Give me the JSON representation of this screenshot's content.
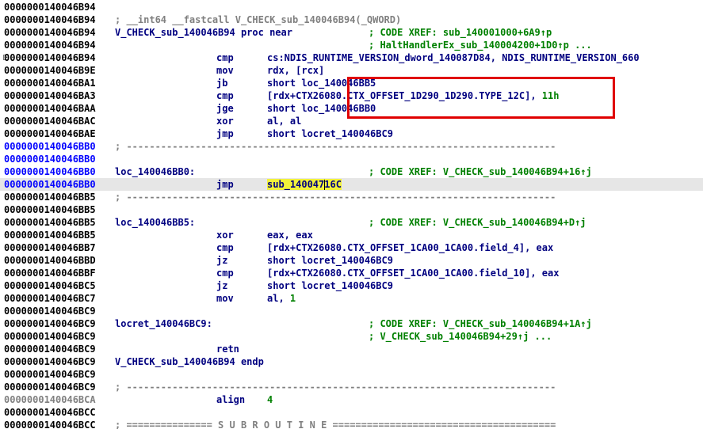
{
  "listing": [
    {
      "kind": "blank",
      "addr": "0000000140046B94",
      "addr_color": "black"
    },
    {
      "kind": "header",
      "addr": "0000000140046B94",
      "addr_color": "black",
      "text": "; __int64 __fastcall V_CHECK_sub_140046B94(_QWORD)"
    },
    {
      "kind": "proc",
      "addr": "0000000140046B94",
      "addr_color": "black",
      "label": "V_CHECK_sub_140046B94 proc near",
      "comment": "; CODE XREF: sub_140001000+6A9↑p"
    },
    {
      "kind": "xref-cont",
      "addr": "0000000140046B94",
      "addr_color": "black",
      "comment": "; HaltHandlerEx_sub_140004200+1D0↑p ..."
    },
    {
      "kind": "insn",
      "addr": "0000000140046B94",
      "addr_color": "black",
      "gutter": true,
      "mnem": "cmp",
      "oper": "cs:NDIS_RUNTIME_VERSION_dword_140087D84, NDIS_RUNTIME_VERSION_660"
    },
    {
      "kind": "insn",
      "addr": "0000000140046B9E",
      "addr_color": "black",
      "mnem": "mov",
      "oper": "rdx, [rcx]"
    },
    {
      "kind": "insn",
      "addr": "0000000140046BA1",
      "addr_color": "black",
      "mnem": "jb",
      "oper": "short loc_140046BB5"
    },
    {
      "kind": "insn-num",
      "addr": "0000000140046BA3",
      "addr_color": "black",
      "mnem": "cmp",
      "oper": "[rdx+CTX26080.CTX_OFFSET_1D290_1D290.TYPE_12C], ",
      "num": "11h"
    },
    {
      "kind": "insn",
      "addr": "0000000140046BAA",
      "addr_color": "black",
      "mnem": "jge",
      "oper": "short loc_140046BB0"
    },
    {
      "kind": "insn",
      "addr": "0000000140046BAC",
      "addr_color": "black",
      "mnem": "xor",
      "oper": "al, al"
    },
    {
      "kind": "insn",
      "addr": "0000000140046BAE",
      "addr_color": "black",
      "mnem": "jmp",
      "oper": "short locret_140046BC9"
    },
    {
      "kind": "sep",
      "addr": "0000000140046BB0",
      "addr_color": "blue",
      "text": "; ---------------------------------------------------------------------------"
    },
    {
      "kind": "blank",
      "addr": "0000000140046BB0",
      "addr_color": "blue"
    },
    {
      "kind": "label",
      "addr": "0000000140046BB0",
      "addr_color": "blue",
      "label": "loc_140046BB0:",
      "comment": "; CODE XREF: V_CHECK_sub_140046B94+16↑j"
    },
    {
      "kind": "insn-cursor",
      "addr": "0000000140046BB0",
      "addr_color": "blue",
      "mnem": "jmp",
      "oper_pre": "sub_140047",
      "oper_post": "16C"
    },
    {
      "kind": "sep",
      "addr": "0000000140046BB5",
      "addr_color": "black",
      "text": "; ---------------------------------------------------------------------------"
    },
    {
      "kind": "blank",
      "addr": "0000000140046BB5",
      "addr_color": "black"
    },
    {
      "kind": "label",
      "addr": "0000000140046BB5",
      "addr_color": "black",
      "label": "loc_140046BB5:",
      "comment": "; CODE XREF: V_CHECK_sub_140046B94+D↑j"
    },
    {
      "kind": "insn",
      "addr": "0000000140046BB5",
      "addr_color": "black",
      "mnem": "xor",
      "oper": "eax, eax"
    },
    {
      "kind": "insn",
      "addr": "0000000140046BB7",
      "addr_color": "black",
      "mnem": "cmp",
      "oper": "[rdx+CTX26080.CTX_OFFSET_1CA00_1CA00.field_4], eax"
    },
    {
      "kind": "insn",
      "addr": "0000000140046BBD",
      "addr_color": "black",
      "mnem": "jz",
      "oper": "short locret_140046BC9"
    },
    {
      "kind": "insn",
      "addr": "0000000140046BBF",
      "addr_color": "black",
      "mnem": "cmp",
      "oper": "[rdx+CTX26080.CTX_OFFSET_1CA00_1CA00.field_10], eax"
    },
    {
      "kind": "insn",
      "addr": "0000000140046BC5",
      "addr_color": "black",
      "mnem": "jz",
      "oper": "short locret_140046BC9"
    },
    {
      "kind": "insn-num",
      "addr": "0000000140046BC7",
      "addr_color": "black",
      "mnem": "mov",
      "oper": "al, ",
      "num": "1"
    },
    {
      "kind": "blank",
      "addr": "0000000140046BC9",
      "addr_color": "black"
    },
    {
      "kind": "label",
      "addr": "0000000140046BC9",
      "addr_color": "black",
      "label": "locret_140046BC9:",
      "comment": "; CODE XREF: V_CHECK_sub_140046B94+1A↑j"
    },
    {
      "kind": "xref-cont",
      "addr": "0000000140046BC9",
      "addr_color": "black",
      "comment": "; V_CHECK_sub_140046B94+29↑j ..."
    },
    {
      "kind": "insn",
      "addr": "0000000140046BC9",
      "addr_color": "black",
      "mnem": "retn",
      "oper": ""
    },
    {
      "kind": "proc-end",
      "addr": "0000000140046BC9",
      "addr_color": "black",
      "label": "V_CHECK_sub_140046B94 endp"
    },
    {
      "kind": "blank",
      "addr": "0000000140046BC9",
      "addr_color": "black"
    },
    {
      "kind": "sep",
      "addr": "0000000140046BC9",
      "addr_color": "black",
      "text": "; ---------------------------------------------------------------------------"
    },
    {
      "kind": "insn-num",
      "addr": "0000000140046BCA",
      "addr_color": "gray",
      "mnem": "align",
      "oper": "",
      "num": "4"
    },
    {
      "kind": "blank",
      "addr": "0000000140046BCC",
      "addr_color": "black"
    },
    {
      "kind": "seg",
      "addr": "0000000140046BCC",
      "addr_color": "black",
      "text": "; =============== S U B R O U T I N E ======================================="
    }
  ],
  "colors": {
    "address_default": "#000000",
    "address_loc": "#0000ff",
    "address_align": "#808080",
    "code": "#000080",
    "comment_xref": "#008000",
    "numbers": "#008000",
    "separator": "#808080",
    "cursor_line_bg": "#e6e6e6",
    "highlight": "#f2f23a",
    "annotation_box": "#e00000"
  }
}
